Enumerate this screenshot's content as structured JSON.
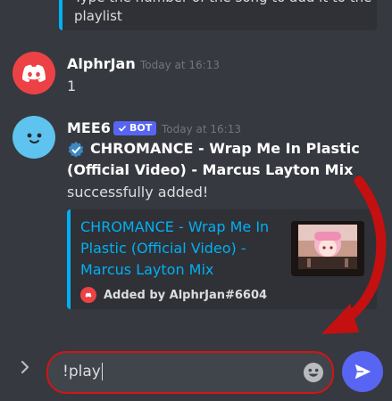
{
  "previous_embed": {
    "line1": "Type the number of the song to add it to the",
    "line2": "playlist"
  },
  "messages": [
    {
      "username": "AlphrJan",
      "timestamp": "Today at 16:13",
      "text": "1",
      "avatar_icon": "discord-logo"
    },
    {
      "username": "MEE6",
      "badge": "BOT",
      "timestamp": "Today at 16:13",
      "title_line1": "CHROMANCE - Wrap Me In Plastic",
      "title_line2": "(Official Video) - Marcus Layton Mix",
      "text": "successfully added!",
      "avatar_icon": "mee6-face",
      "embed": {
        "title_line1": "CHROMANCE - Wrap Me In",
        "title_line2": "Plastic (Official Video) -",
        "title_line3": "Marcus Layton Mix",
        "footer": "Added by AlphrJan#6604",
        "thumbnail": "video-thumbnail"
      }
    }
  ],
  "composer": {
    "value": "!play",
    "expand_icon": "chevron-right-icon",
    "emoji_icon": "emoji-icon",
    "send_icon": "send-icon"
  },
  "colors": {
    "background": "#36393f",
    "embed_bg": "#2f3136",
    "link": "#00b0f4",
    "blurple": "#5865f2",
    "highlight": "#d51414"
  }
}
